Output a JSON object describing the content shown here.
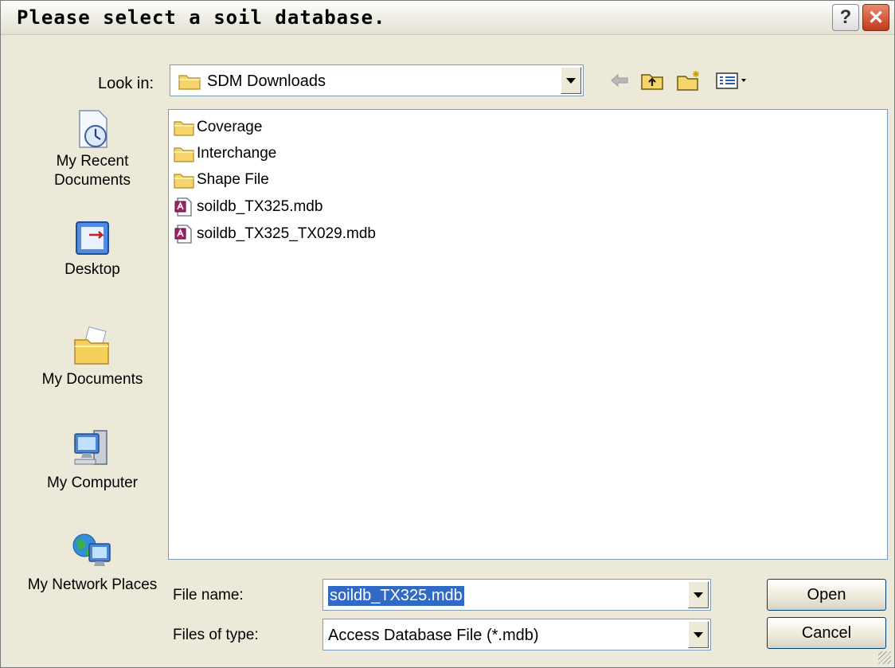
{
  "window": {
    "title": "Please select a soil database."
  },
  "titlebar_buttons": {
    "help_glyph": "?",
    "close_glyph": "✕"
  },
  "lookin": {
    "label": "Look in:",
    "value": "SDM Downloads",
    "icon": "folder-icon"
  },
  "toolbar": {
    "icons": [
      "back-arrow-icon",
      "up-folder-icon",
      "new-folder-icon",
      "view-menu-icon"
    ]
  },
  "places": [
    {
      "label": "My Recent Documents",
      "icon": "recent-documents-icon"
    },
    {
      "label": "Desktop",
      "icon": "desktop-icon"
    },
    {
      "label": "My Documents",
      "icon": "my-documents-icon"
    },
    {
      "label": "My Computer",
      "icon": "my-computer-icon"
    },
    {
      "label": "My Network Places",
      "icon": "network-places-icon"
    }
  ],
  "files": [
    {
      "name": "Coverage",
      "type": "folder"
    },
    {
      "name": "Interchange",
      "type": "folder"
    },
    {
      "name": "Shape File",
      "type": "folder"
    },
    {
      "name": "soildb_TX325.mdb",
      "type": "access-db"
    },
    {
      "name": "soildb_TX325_TX029.mdb",
      "type": "access-db"
    }
  ],
  "filename": {
    "label": "File name:",
    "value": "soildb_TX325.mdb"
  },
  "filetype": {
    "label": "Files of type:",
    "value": "Access Database File (*.mdb)"
  },
  "buttons": {
    "open": "Open",
    "cancel": "Cancel"
  },
  "colors": {
    "selection": "#316ac5",
    "chrome": "#ece9d8",
    "folder": "#f5d46b",
    "close": "#c0391b"
  }
}
